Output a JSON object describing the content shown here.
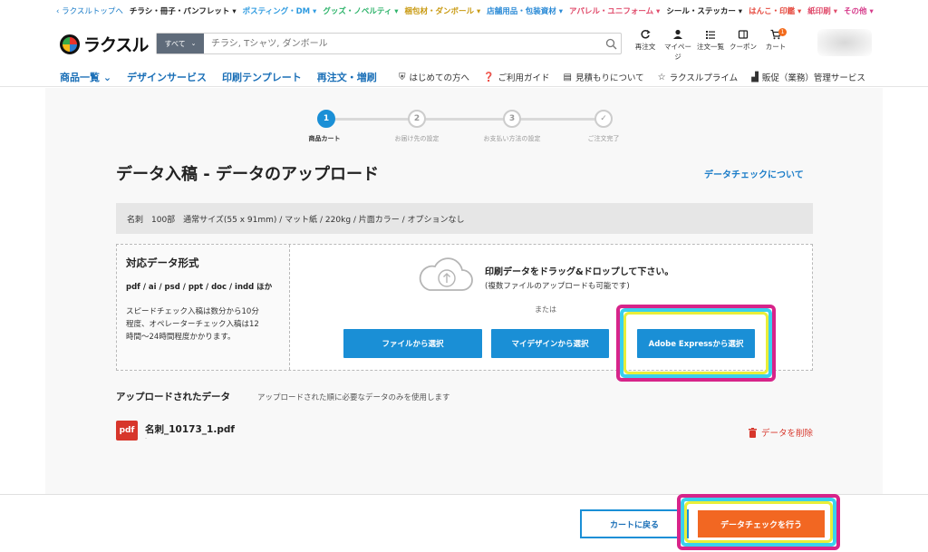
{
  "topbar": {
    "items": [
      {
        "label": "‹ ラクスルトップへ",
        "color": "#1a7cc8"
      },
      {
        "label": "チラシ・冊子・パンフレット ▾",
        "color": "#222222"
      },
      {
        "label": "ポスティング・DM ▾",
        "color": "#2f9be0"
      },
      {
        "label": "グッズ・ノベルティ ▾",
        "color": "#2db36a"
      },
      {
        "label": "梱包材・ダンボール ▾",
        "color": "#c99a12"
      },
      {
        "label": "店舗用品・包装資材 ▾",
        "color": "#2a8ad6"
      },
      {
        "label": "アパレル・ユニフォーム ▾",
        "color": "#e04a6a"
      },
      {
        "label": "シール・ステッカー ▾",
        "color": "#222222"
      },
      {
        "label": "はんこ・印鑑 ▾",
        "color": "#e5473c"
      },
      {
        "label": "紙印刷 ▾",
        "color": "#e04a6a"
      },
      {
        "label": "その他 ▾",
        "color": "#d63a8a"
      }
    ]
  },
  "header": {
    "logo_text": "ラクスル",
    "search_category": "すべて",
    "search_placeholder": "チラシ, Tシャツ, ダンボール",
    "icons": [
      {
        "name": "reorder",
        "label": "再注文"
      },
      {
        "name": "mypage",
        "label": "マイページ"
      },
      {
        "name": "orders",
        "label": "注文一覧"
      },
      {
        "name": "coupon",
        "label": "クーポン"
      },
      {
        "name": "cart",
        "label": "カート",
        "badge": "1"
      }
    ]
  },
  "nav": {
    "left": [
      "商品一覧 ⌄",
      "デザインサービス",
      "印刷テンプレート",
      "再注文・増刷"
    ],
    "right": [
      {
        "icon": "shield",
        "label": "はじめての方へ"
      },
      {
        "icon": "help",
        "label": "ご利用ガイド"
      },
      {
        "icon": "doc",
        "label": "見積もりについて"
      },
      {
        "icon": "star",
        "label": "ラクスルプライム"
      },
      {
        "icon": "building",
        "label": "販促（業務）管理サービス"
      }
    ]
  },
  "stepper": {
    "steps": [
      {
        "num": "1",
        "label": "商品カート",
        "active": true
      },
      {
        "num": "2",
        "label": "お届け先の設定",
        "active": false
      },
      {
        "num": "3",
        "label": "お支払い方法の設定",
        "active": false
      },
      {
        "num": "✓",
        "label": "ご注文完了",
        "active": false
      }
    ]
  },
  "page": {
    "title": "データ入稿 - データのアップロード",
    "about_link": "データチェックについて",
    "order_summary": "名刺　100部　通常サイズ(55 x 91mm) / マット紙 / 220kg / 片面カラー / オプションなし"
  },
  "formats": {
    "heading": "対応データ形式",
    "extensions": "pdf / ai / psd / ppt / doc / indd ほか",
    "note_lines": [
      "スピードチェック入稿は数分から10分",
      "程度、オペレーターチェック入稿は12",
      "時間〜24時間程度かかります。"
    ]
  },
  "drop": {
    "title": "印刷データをドラッグ&ドロップして下さい。",
    "subtitle": "(複数ファイルのアップロードも可能です)",
    "or": "または",
    "btn_file": "ファイルから選択",
    "btn_mydesign": "マイデザインから選択",
    "btn_adobe": "Adobe Expressから選択"
  },
  "uploaded": {
    "heading": "アップロードされたデータ",
    "sub": "アップロードされた順に必要なデータのみを使用します",
    "file_icon": "pdf",
    "file_name": "名刺_10173_1.pdf",
    "file_meta": "-",
    "delete_label": "データを削除"
  },
  "footer": {
    "back_cart": "カートに戻る",
    "data_check": "データチェックを行う"
  },
  "colors": {
    "accent_blue": "#1a8fd6",
    "cta_orange": "#f26722",
    "danger": "#d7362b",
    "highlight_ring": [
      "#d7248a",
      "#3ad0ee",
      "#e8ee3a"
    ]
  }
}
